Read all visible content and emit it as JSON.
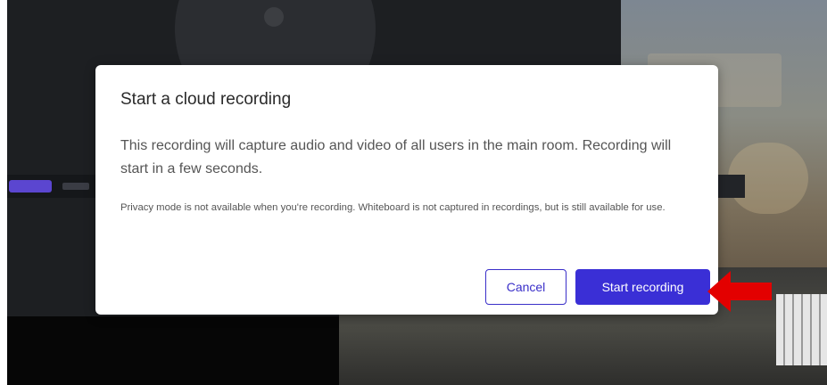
{
  "dialog": {
    "title": "Start a cloud recording",
    "body": "This recording will capture audio and video of all users in the main room. Recording will start in a few seconds.",
    "note": "Privacy mode is not available when you're recording. Whiteboard is not captured in recordings, but is still available for use.",
    "cancel_label": "Cancel",
    "start_label": "Start recording"
  },
  "colors": {
    "accent": "#3a2fd6",
    "annotation_arrow": "#e30000"
  }
}
